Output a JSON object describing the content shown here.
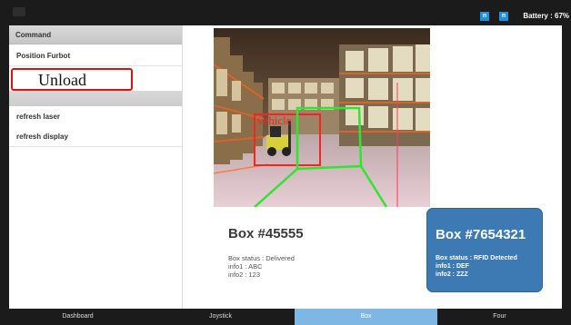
{
  "status": {
    "battery": "Battery : 67%",
    "icon1": "n",
    "icon2": "n"
  },
  "sidebar": {
    "header": "Command",
    "items": [
      {
        "label": "Position Furbot"
      },
      {
        "label": "Unload"
      },
      {
        "label": "refresh laser"
      },
      {
        "label": "refresh display"
      }
    ]
  },
  "camera": {
    "overlay_label": "vehicle"
  },
  "box_primary": {
    "title": "Box #45555",
    "status": "Box status : Delivered",
    "info1": "info1 : ABC",
    "info2": "info2 : 123"
  },
  "box_secondary": {
    "title": "Box #7654321",
    "status": "Box status : RFID Detected",
    "info1": "info1 : DEF",
    "info2": "info2 : ZZZ",
    "color": "#3d7ab3"
  },
  "tabs": [
    {
      "label": "Dashboard"
    },
    {
      "label": "Joystick"
    },
    {
      "label": "Box",
      "active": true
    },
    {
      "label": "Four"
    }
  ]
}
